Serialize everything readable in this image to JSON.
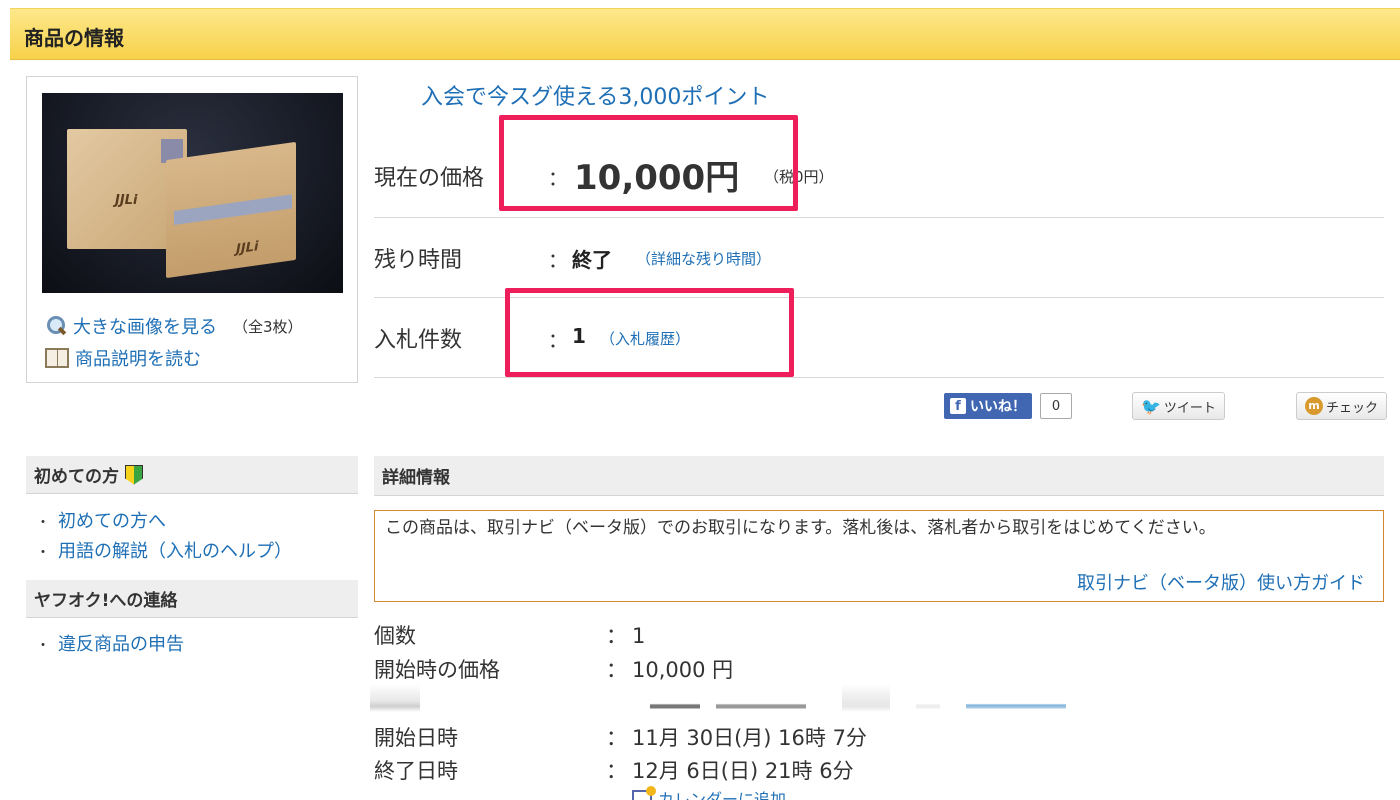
{
  "header": {
    "title": "商品の情報"
  },
  "gallery": {
    "photo_alt": "商品画像",
    "view_large_label": "大きな画像を見る",
    "image_count": "（全3枚）",
    "read_description_label": "商品説明を読む"
  },
  "promo": {
    "points_link": "入会で今スグ使える3,000ポイント"
  },
  "price": {
    "label": "現在の価格",
    "colon": "：",
    "value": "10,000円",
    "tax_note": "（税0円）"
  },
  "time_left": {
    "label": "残り時間",
    "colon": "：",
    "value": "終了",
    "detail_link": "（詳細な残り時間）"
  },
  "bids": {
    "label": "入札件数",
    "colon": "：",
    "value": "1",
    "history_link": "（入札履歴）"
  },
  "social": {
    "like_label": "いいね！",
    "like_count": "0",
    "tweet_label": "ツイート",
    "check_label": "チェック"
  },
  "sidebar": {
    "beginner_heading": "初めての方",
    "beginner_links": [
      "初めての方へ",
      "用語の解説（入札のヘルプ）"
    ],
    "contact_heading": "ヤフオク!への連絡",
    "contact_links": [
      "違反商品の申告"
    ]
  },
  "details": {
    "heading": "詳細情報",
    "notice_text": "この商品は、取引ナビ（ベータ版）でのお取引になります。落札後は、落札者から取引をはじめてください。",
    "notice_link": "取引ナビ（ベータ版）使い方ガイド",
    "specs": [
      {
        "key": "個数",
        "colon": "：",
        "value": "1"
      },
      {
        "key": "開始時の価格",
        "colon": "：",
        "value": "10,000 円"
      },
      {
        "key": "開始日時",
        "colon": "：",
        "value": "11月 30日(月) 16時 7分"
      },
      {
        "key": "終了日時",
        "colon": "：",
        "value": "12月 6日(日) 21時 6分"
      }
    ],
    "calendar_link": "カレンダーに追加"
  },
  "colors": {
    "accent_link": "#1e6fb5",
    "highlight": "#ee1e5a",
    "header_bg": "#f7d14a",
    "notice_border": "#d48a2c"
  }
}
